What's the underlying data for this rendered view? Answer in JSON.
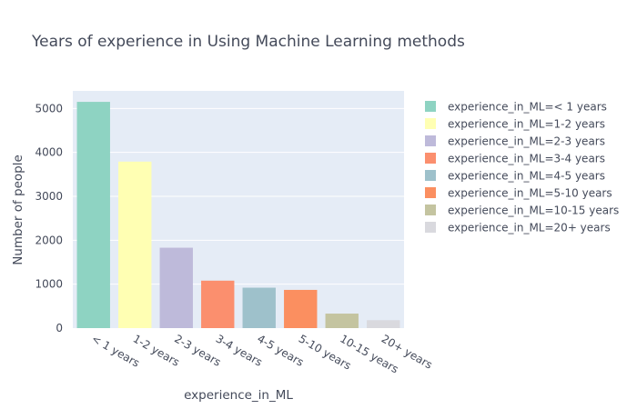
{
  "chart_data": {
    "type": "bar",
    "title": "Years of experience in Using Machine Learning methods",
    "xlabel": "experience_in_ML",
    "ylabel": "Number of people",
    "ylim": [
      0,
      5400
    ],
    "yticks": [
      0,
      1000,
      2000,
      3000,
      4000,
      5000
    ],
    "yticks_text": [
      "0",
      "1000",
      "2000",
      "3000",
      "4000",
      "5000"
    ],
    "grid": true,
    "legend_position": "right",
    "categories": [
      "< 1 years",
      "1-2 years",
      "2-3 years",
      "3-4 years",
      "4-5 years",
      "5-10 years",
      "10-15 years",
      "20+ years"
    ],
    "series": [
      {
        "name": "experience_in_ML=< 1 years",
        "values": [
          5150
        ],
        "color": "#8ed3c2"
      },
      {
        "name": "experience_in_ML=1-2 years",
        "values": [
          3790
        ],
        "color": "#ffffb3"
      },
      {
        "name": "experience_in_ML=2-3 years",
        "values": [
          1830
        ],
        "color": "#bebada"
      },
      {
        "name": "experience_in_ML=3-4 years",
        "values": [
          1080
        ],
        "color": "#fb8f6e"
      },
      {
        "name": "experience_in_ML=4-5 years",
        "values": [
          920
        ],
        "color": "#9ec1cb"
      },
      {
        "name": "experience_in_ML=5-10 years",
        "values": [
          870
        ],
        "color": "#fb8f60"
      },
      {
        "name": "experience_in_ML=10-15 years",
        "values": [
          330
        ],
        "color": "#c4c4a0"
      },
      {
        "name": "experience_in_ML=20+ years",
        "values": [
          180
        ],
        "color": "#d9d9de"
      }
    ],
    "plot_background": "#e5ecf6"
  }
}
